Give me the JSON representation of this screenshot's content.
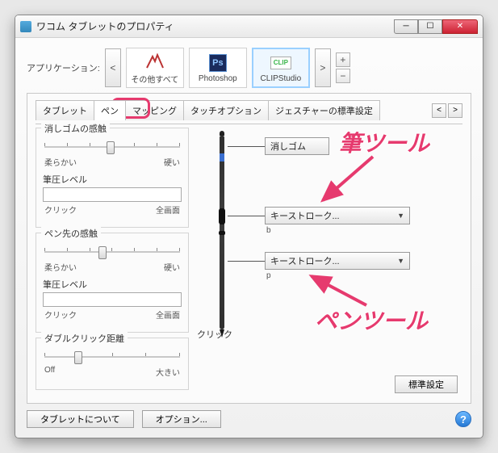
{
  "window": {
    "title": "ワコム タブレットのプロパティ"
  },
  "approw_label": "アプリケーション:",
  "apps": [
    {
      "label": "その他すべて"
    },
    {
      "label": "Photoshop"
    },
    {
      "label": "CLIPStudio"
    }
  ],
  "tabs": {
    "tablet": "タブレット",
    "pen": "ペン",
    "mapping": "マッピング",
    "touch": "タッチオプション",
    "gesture": "ジェスチャーの標準設定"
  },
  "eraser_group": {
    "title": "消しゴムの感触",
    "soft": "柔らかい",
    "hard": "硬い",
    "pressure_label": "筆圧レベル",
    "click": "クリック",
    "full": "全画面"
  },
  "tip_group": {
    "title": "ペン先の感触",
    "soft": "柔らかい",
    "hard": "硬い",
    "pressure_label": "筆圧レベル",
    "click": "クリック",
    "full": "全画面"
  },
  "dblclick_group": {
    "title": "ダブルクリック距離",
    "off": "Off",
    "large": "大きい"
  },
  "assign": {
    "eraser": "消しゴム",
    "upper": "キーストローク...",
    "upper_sub": "b",
    "lower": "キーストローク...",
    "lower_sub": "p",
    "click_label": "クリック"
  },
  "buttons": {
    "default": "標準設定",
    "about": "タブレットについて",
    "options": "オプション..."
  },
  "annotations": {
    "brush": "筆ツール",
    "pen": "ペンツール"
  }
}
